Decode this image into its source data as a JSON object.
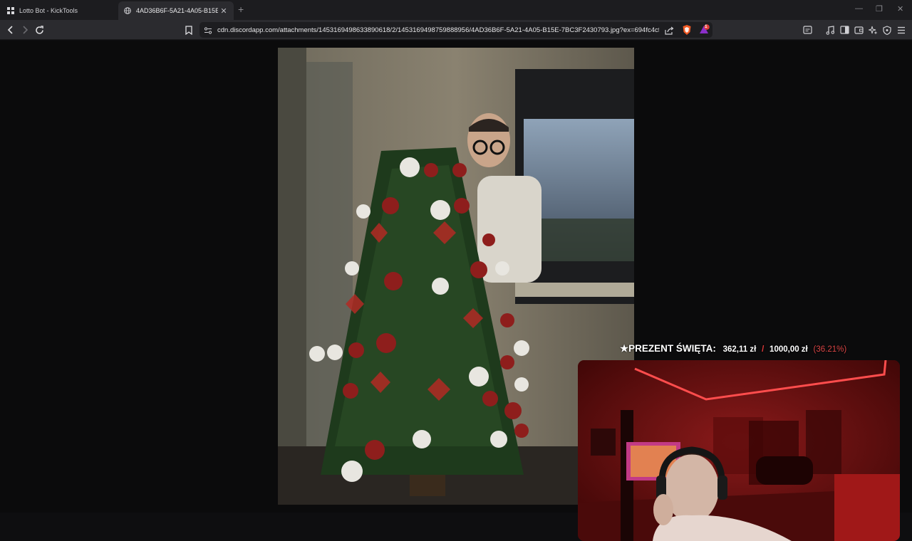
{
  "tabs": [
    {
      "title": "Lotto Bot - KickTools",
      "active": false
    },
    {
      "title": "4AD36B6F-5A21-4A05-B15E-7B",
      "active": true
    }
  ],
  "toolbar": {
    "url": "cdn.discordapp.com/attachments/1453169498633890618/2/1453169498759888956/4AD36B6F-5A21-4A05-B15E-7BC3F2430793.jpg?ex=694fc4cf&is=...",
    "shield_badge": "1"
  },
  "overlay": {
    "label": "★PREZENT ŚWIĘTA:",
    "current": "362,11 zł",
    "separator": "/",
    "goal": "1000,00 zł",
    "percent": "(36.21%)",
    "progress_fraction": 0.3621
  },
  "colors": {
    "accent_red": "#e33b3b",
    "brave_orange": "#f15a24"
  }
}
